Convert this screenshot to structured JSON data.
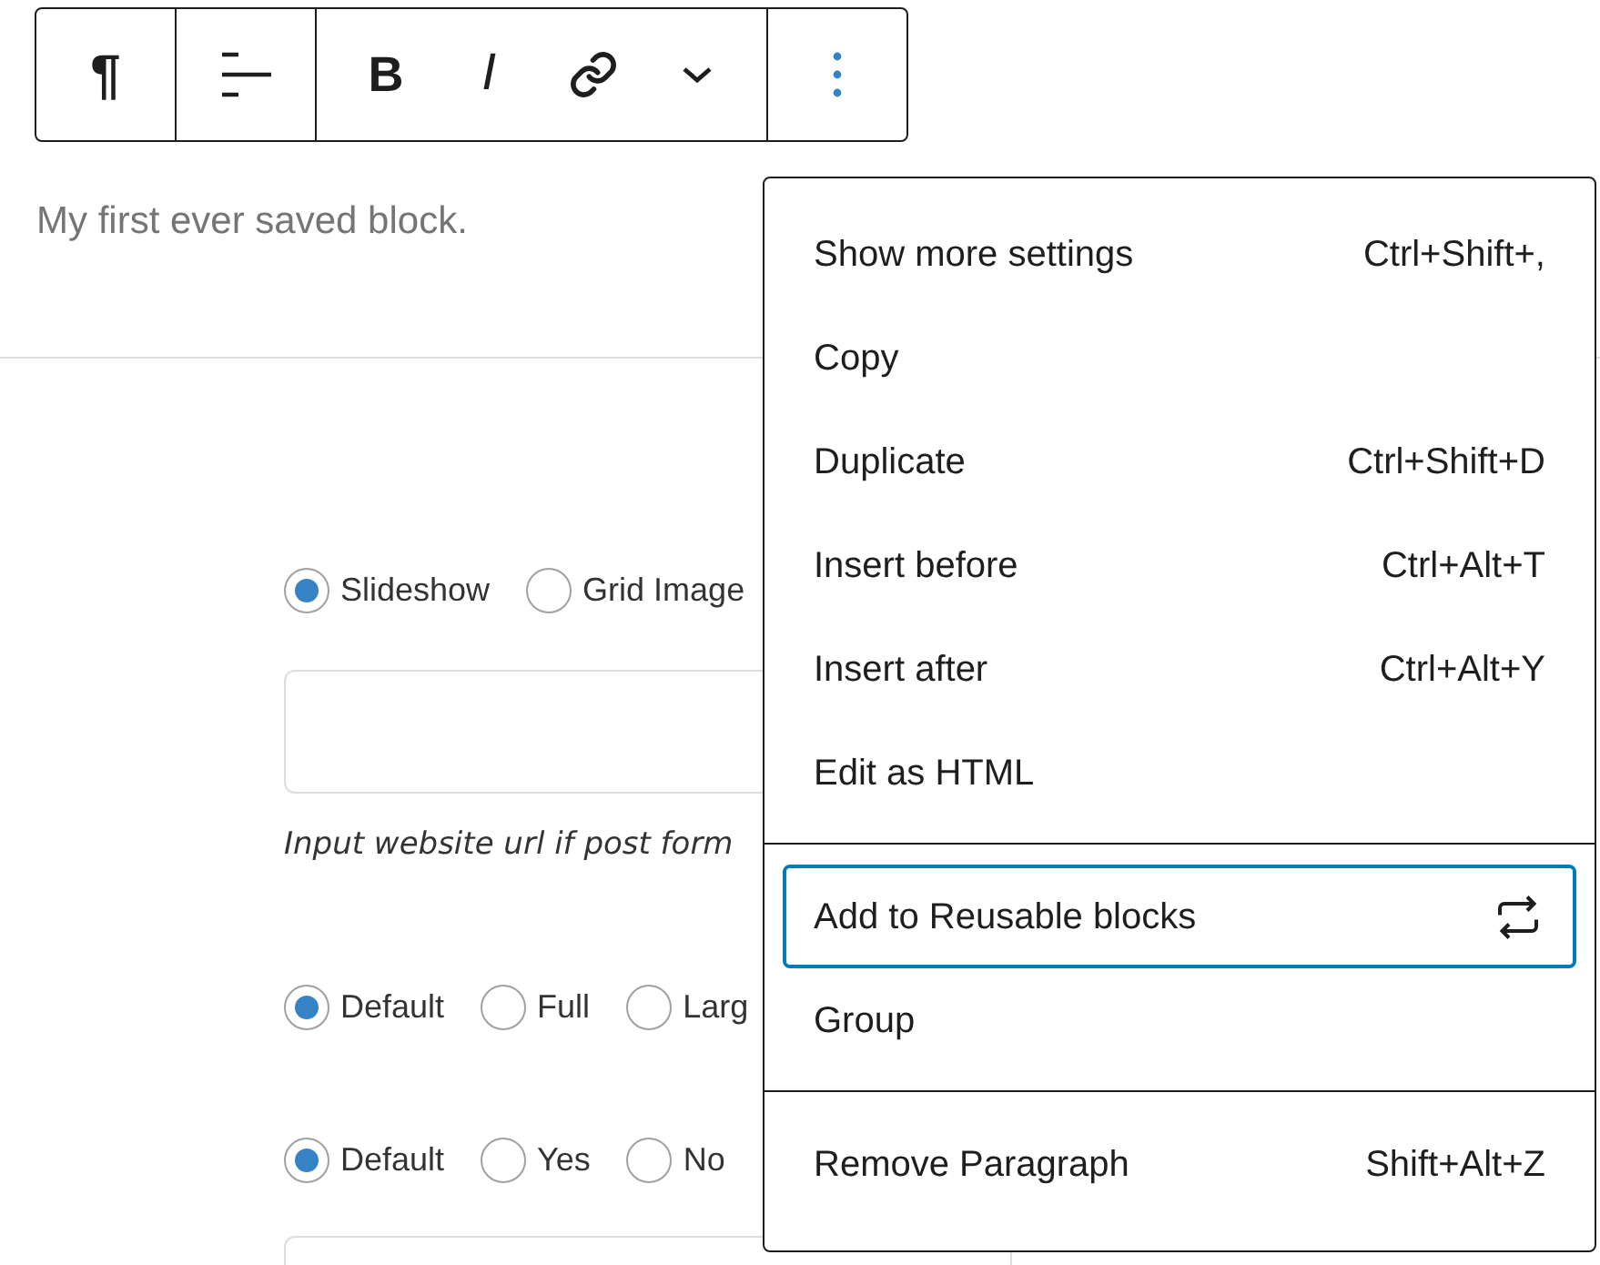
{
  "subtitle": "My first ever saved block.",
  "toolbar": {
    "groups": [
      [
        {
          "kind": "paragraph",
          "label": "¶"
        }
      ],
      [
        {
          "kind": "align"
        }
      ],
      [
        {
          "kind": "bold",
          "label": "B"
        },
        {
          "kind": "italic",
          "label": "I"
        },
        {
          "kind": "link"
        },
        {
          "kind": "chevron"
        }
      ],
      [
        {
          "kind": "more"
        }
      ]
    ]
  },
  "format_options": [
    {
      "label": "Slideshow",
      "selected": true
    },
    {
      "label": "Grid Image",
      "selected": false
    }
  ],
  "url_hint": "Input website url if post form",
  "layout_options": [
    {
      "label": "Default",
      "selected": true
    },
    {
      "label": "Full",
      "selected": false
    },
    {
      "label": "Larg",
      "selected": false
    }
  ],
  "sidebar_options": [
    {
      "label": "Default",
      "selected": true
    },
    {
      "label": "Yes",
      "selected": false
    },
    {
      "label": "No",
      "selected": false
    }
  ],
  "menu": {
    "sections": [
      [
        {
          "kind": "shortcut",
          "label": "Show more settings",
          "shortcut": "Ctrl+Shift+,",
          "focused": false
        },
        {
          "kind": "plain",
          "label": "Copy",
          "focused": false
        },
        {
          "kind": "shortcut",
          "label": "Duplicate",
          "shortcut": "Ctrl+Shift+D",
          "focused": false
        },
        {
          "kind": "shortcut",
          "label": "Insert before",
          "shortcut": "Ctrl+Alt+T",
          "focused": false
        },
        {
          "kind": "shortcut",
          "label": "Insert after",
          "shortcut": "Ctrl+Alt+Y",
          "focused": false
        },
        {
          "kind": "plain",
          "label": "Edit as HTML",
          "focused": false
        }
      ],
      [
        {
          "kind": "icon",
          "label": "Add to Reusable blocks",
          "focused": true
        },
        {
          "kind": "plain",
          "label": "Group",
          "focused": false
        }
      ],
      [
        {
          "kind": "shortcut",
          "label": "Remove Paragraph",
          "shortcut": "Shift+Alt+Z",
          "focused": false
        }
      ]
    ]
  }
}
